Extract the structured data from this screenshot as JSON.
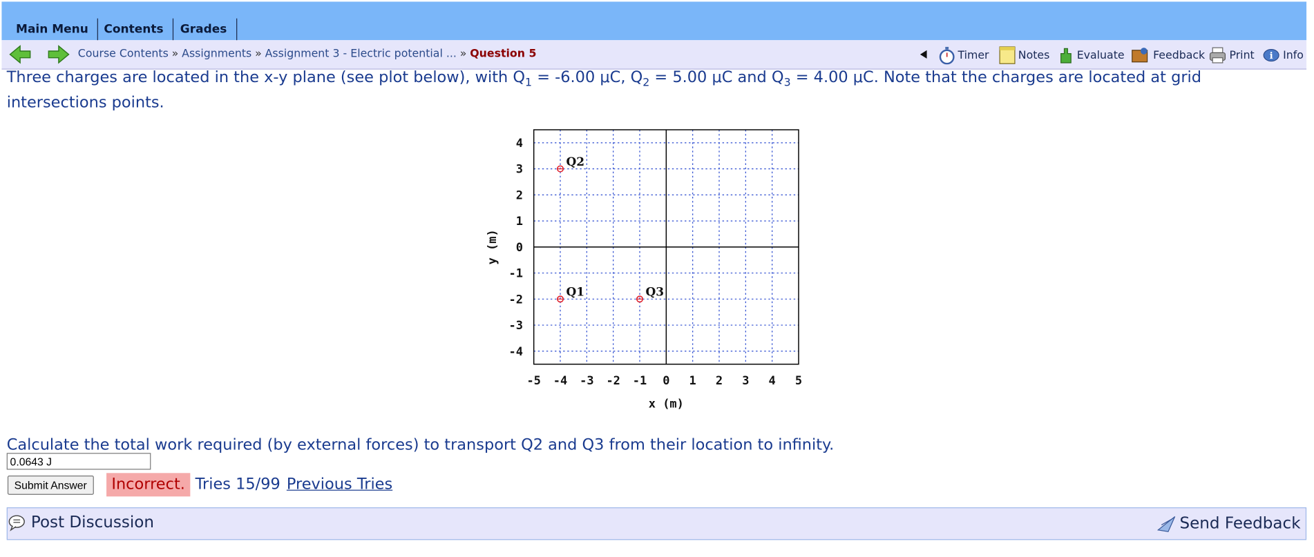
{
  "menu": {
    "items": [
      "Main Menu",
      "Contents",
      "Grades"
    ]
  },
  "breadcrumb": {
    "course": "Course Contents",
    "assignments": "Assignments",
    "assignment": "Assignment 3 - Electric potential ...",
    "current": "Question 5",
    "separator": "»"
  },
  "tools": {
    "timer": "Timer",
    "notes": "Notes",
    "evaluate": "Evaluate",
    "feedback": "Feedback",
    "print": "Print",
    "info": "Info"
  },
  "question": {
    "intro": "Three charges are located in the x-y plane (see plot below), with Q",
    "s1": "1",
    "v1": " = -6.00 μC, Q",
    "s2": "2",
    "v2": " = 5.00 μC and Q",
    "s3": "3",
    "v3": " = 4.00 μC. Note that the charges are located at grid intersections points.",
    "prompt": "Calculate the total work required (by external forces) to transport Q2 and Q3 from their location to infinity."
  },
  "answer": {
    "value": "0.0643 J",
    "submit_label": "Submit Answer",
    "status": "Incorrect.",
    "tries": "Tries 15/99",
    "previous_tries": "Previous Tries"
  },
  "discussion": {
    "post": "Post Discussion",
    "send_feedback": "Send Feedback"
  },
  "colors": {
    "topbar": "#7ab6f9",
    "navbar": "#e6e6fb",
    "text": "#1a3b8f",
    "incorrect_bg": "#f5a9a9",
    "marker": "#e0202a",
    "grid": "#2a4ad0"
  },
  "chart_data": {
    "type": "scatter",
    "xlabel": "x (m)",
    "ylabel": "y (m)",
    "xlim": [
      -5,
      5
    ],
    "ylim": [
      -4.5,
      4.5
    ],
    "xticks": [
      -5,
      -4,
      -3,
      -2,
      -1,
      0,
      1,
      2,
      3,
      4,
      5
    ],
    "yticks": [
      -4,
      -3,
      -2,
      -1,
      0,
      1,
      2,
      3,
      4
    ],
    "grid": true,
    "points": [
      {
        "label": "Q2",
        "x": -4,
        "y": 3
      },
      {
        "label": "Q1",
        "x": -4,
        "y": -2
      },
      {
        "label": "Q3",
        "x": -1,
        "y": -2
      }
    ]
  }
}
